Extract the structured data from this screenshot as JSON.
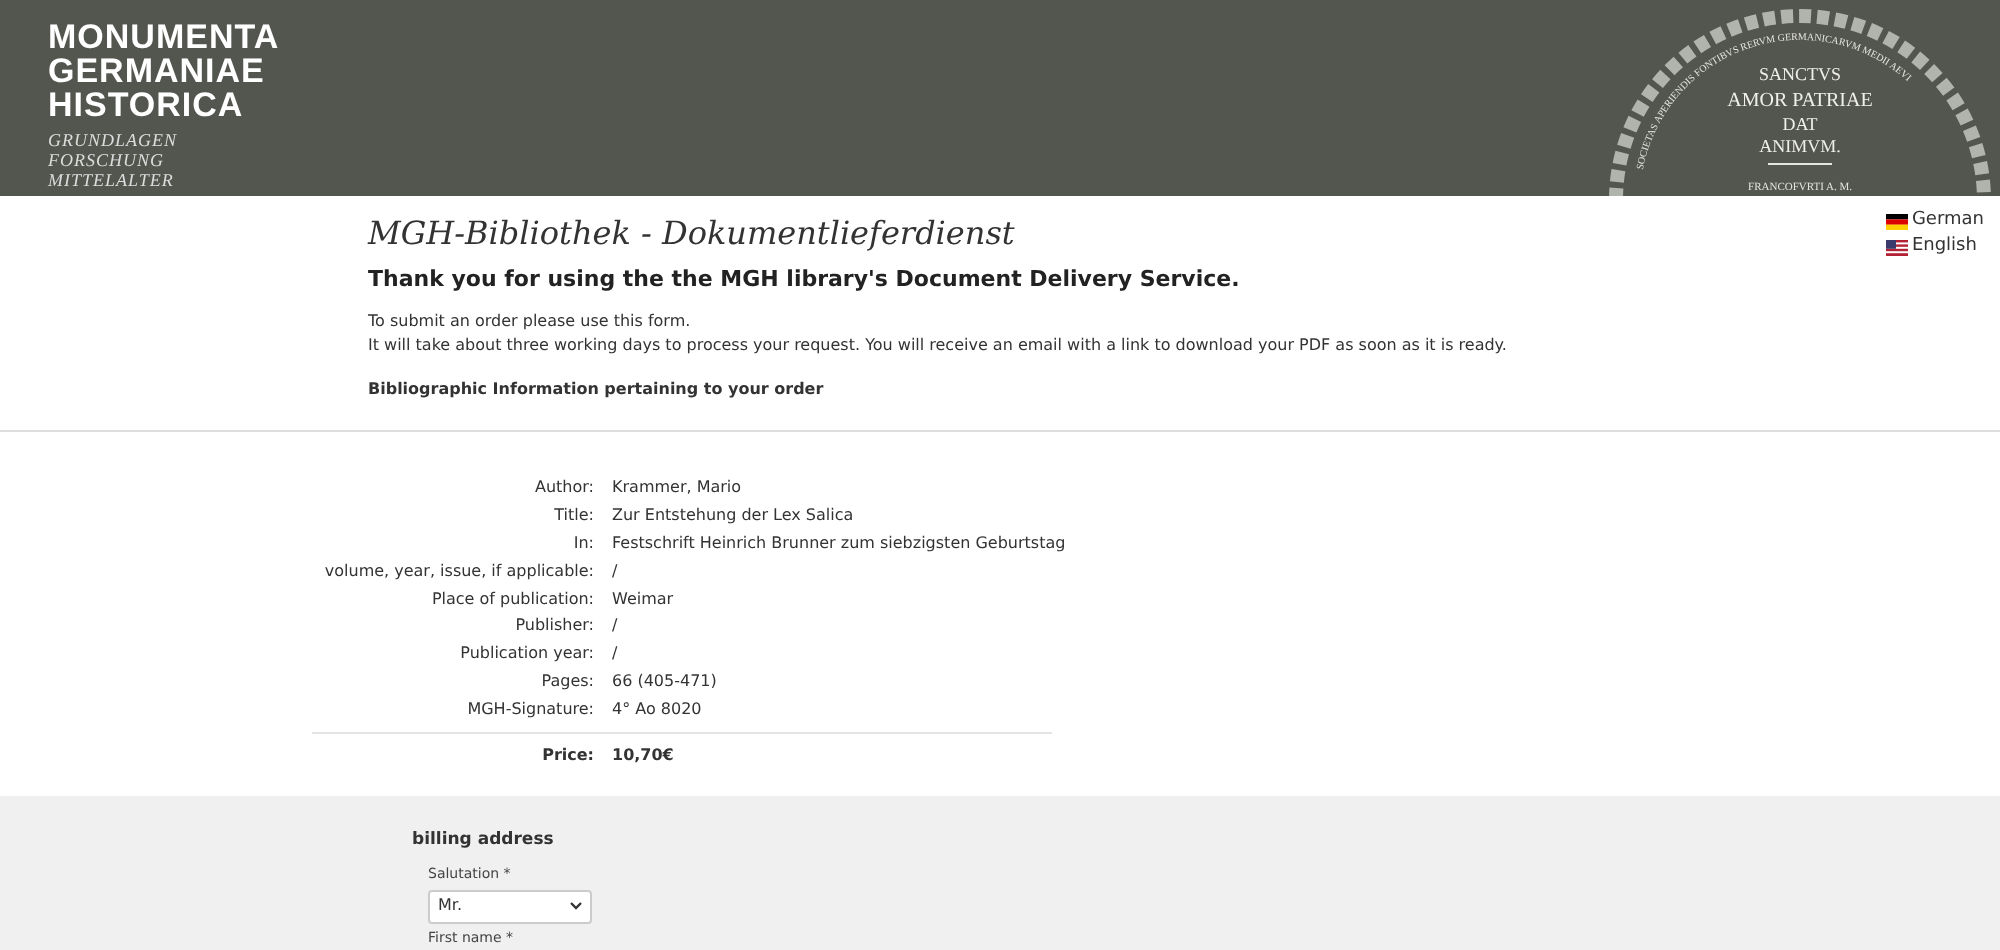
{
  "header": {
    "logo_lines": [
      "MONUMENTA",
      "GERMANIAE",
      "HISTORICA"
    ],
    "tagline_lines": [
      "GRUNDLAGEN",
      "FORSCHUNG",
      "MITTELALTER"
    ],
    "seal": {
      "ring_text": "SOCIETAS APERIENDIS FONTIBVS RERVM GERMANICARVM MEDII AEVI",
      "motto_lines": [
        "SANCTVS",
        "AMOR PATRIAE",
        "DAT",
        "ANIMVM."
      ],
      "place": "FRANCOFVRTI A. M."
    }
  },
  "languages": [
    {
      "kind": "german",
      "label": "German"
    },
    {
      "kind": "english",
      "label": "English"
    }
  ],
  "page_title": "MGH-Bibliothek - Dokumentlieferdienst",
  "intro_heading": "Thank you for using the the MGH library's Document Delivery Service.",
  "intro_lines": [
    "To submit an order please use this form.",
    "It will take about three working days to process your request. You will receive an email with a link to download your PDF as soon as it is ready."
  ],
  "section_heading": "Bibliographic Information pertaining to your order",
  "details": [
    {
      "label": "Author:",
      "value": "Krammer, Mario"
    },
    {
      "label": "Title:",
      "value": "Zur Entstehung der Lex Salica"
    },
    {
      "label": "In:",
      "value": "Festschrift Heinrich Brunner zum siebzigsten Geburtstag"
    },
    {
      "label": "volume, year, issue, if applicable:",
      "value": "/"
    },
    {
      "label": "Place of publication:",
      "value": "Weimar"
    },
    {
      "label": "Publisher:",
      "value": "/"
    },
    {
      "label": "Publication year:",
      "value": "/"
    },
    {
      "label": "Pages:",
      "value": "66 (405-471)"
    },
    {
      "label": "MGH-Signature:",
      "value": "4° Ao 8020"
    }
  ],
  "price": {
    "label": "Price:",
    "value": "10,70€"
  },
  "billing": {
    "heading": "billing address",
    "fields": [
      {
        "kind": "select",
        "label": "Salutation *",
        "value": "Mr."
      },
      {
        "kind": "text",
        "label": "First name *"
      }
    ]
  }
}
